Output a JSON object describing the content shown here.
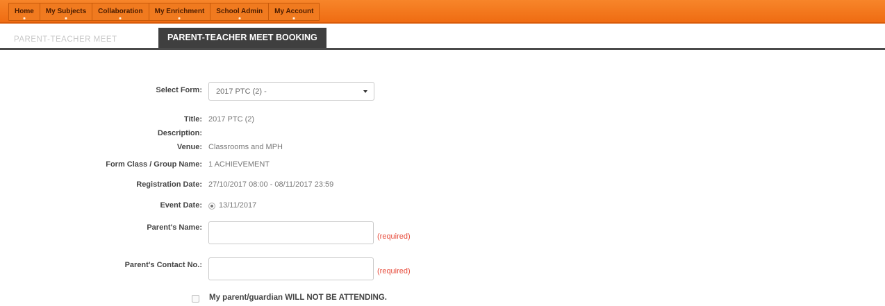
{
  "nav": {
    "items": [
      {
        "label": "Home"
      },
      {
        "label": "My Subjects"
      },
      {
        "label": "Collaboration"
      },
      {
        "label": "My Enrichment"
      },
      {
        "label": "School Admin"
      },
      {
        "label": "My Account"
      }
    ]
  },
  "tabs": {
    "inactive": "PARENT-TEACHER MEET",
    "active": "PARENT-TEACHER MEET BOOKING"
  },
  "form": {
    "select_form_label": "Select Form:",
    "select_form_value": "2017 PTC (2) -",
    "title_label": "Title:",
    "title_value": "2017 PTC (2)",
    "description_label": "Description:",
    "venue_label": "Venue:",
    "venue_value": "Classrooms and MPH",
    "form_class_label": "Form Class / Group Name:",
    "form_class_value": "1 ACHIEVEMENT",
    "registration_label": "Registration Date:",
    "registration_value": "27/10/2017 08:00 - 08/11/2017 23:59",
    "event_date_label": "Event Date:",
    "event_date_value": "13/11/2017",
    "parent_name_label": "Parent's Name:",
    "parent_name_value": "",
    "parent_name_required": "(required)",
    "parent_contact_label": "Parent's Contact No.:",
    "parent_contact_value": "",
    "parent_contact_required": "(required)",
    "not_attending_label": "My parent/guardian WILL NOT BE ATTENDING."
  }
}
